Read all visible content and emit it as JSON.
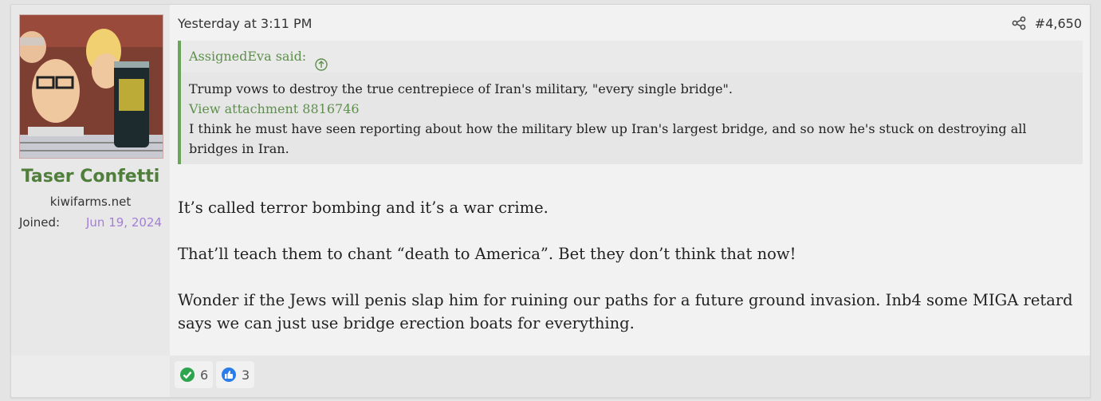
{
  "user": {
    "name": "Taser Confetti",
    "title": "kiwifarms.net",
    "joined_label": "Joined:",
    "joined_value": "Jun 19, 2024",
    "avatar_icon": "avatar-cartoon-with-soda-can"
  },
  "post": {
    "date": "Yesterday at 3:11 PM",
    "number": "#4,650",
    "share_icon": "share-icon"
  },
  "quote": {
    "author": "AssignedEva said:",
    "line1": "Trump vows to destroy the true centrepiece of Iran's military, \"every single bridge\".",
    "attachment": "View attachment 8816746",
    "line2": "I think he must have seen reporting about how the military blew up Iran's largest bridge, and so now he's stuck on destroying all bridges in Iran."
  },
  "message": {
    "p1": "It’s called terror bombing and it’s a war crime.",
    "p2": "That’ll teach them to chant “death to America”. Bet they don’t think that now!",
    "p3": "Wonder if the Jews will penis slap him for ruining our paths for a future ground invasion. Inb4 some MIGA retard says we can just use bridge erection boats for everything."
  },
  "reactions": [
    {
      "icon": "check-icon",
      "count": "6",
      "color": "#2ea44f"
    },
    {
      "icon": "thumbs-up-icon",
      "count": "3",
      "color": "#2b7de9"
    }
  ]
}
